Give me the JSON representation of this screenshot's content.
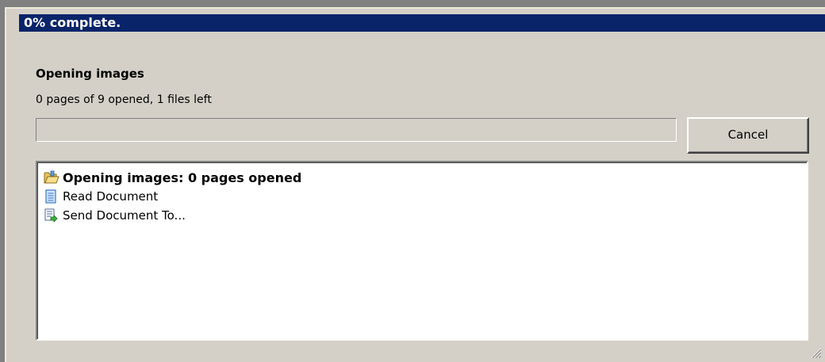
{
  "title": "0% complete.",
  "heading": "Opening images",
  "status": "0 pages of 9 opened, 1 files left",
  "progress": {
    "percent": 0
  },
  "cancel_label": "Cancel",
  "items": [
    {
      "label": "Opening images: 0 pages opened",
      "icon": "folder-open-icon",
      "bold": true
    },
    {
      "label": "Read Document",
      "icon": "document-icon",
      "bold": false
    },
    {
      "label": "Send Document To...",
      "icon": "send-document-icon",
      "bold": false
    }
  ]
}
